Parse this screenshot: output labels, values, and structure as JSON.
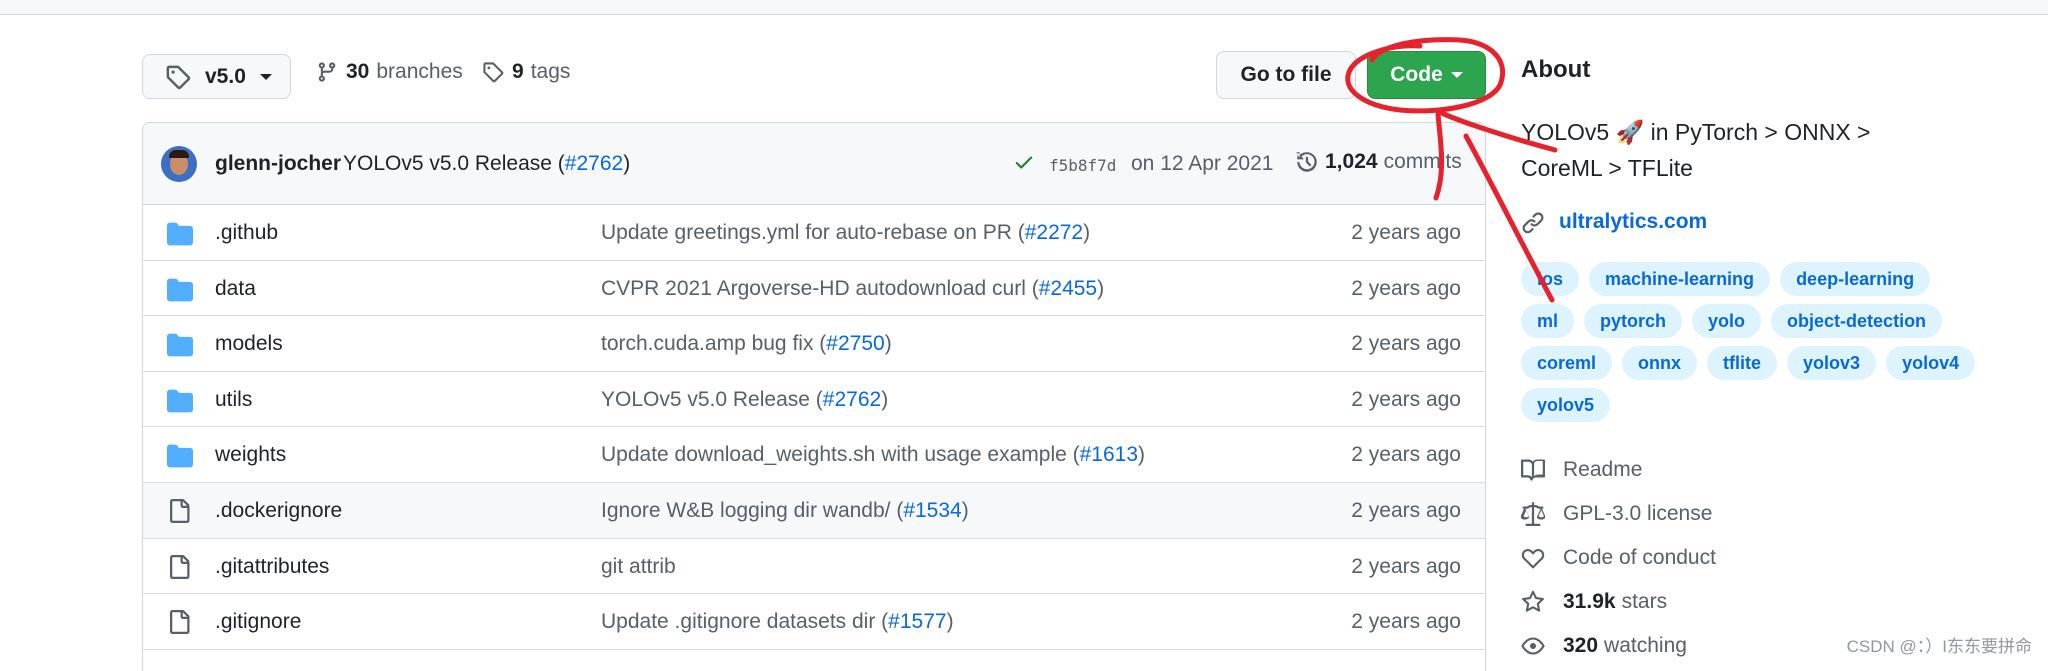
{
  "toolbar": {
    "branch": "v5.0",
    "branches_count": "30",
    "branches_label": "branches",
    "tags_count": "9",
    "tags_label": "tags",
    "go_to_file": "Go to file",
    "code": "Code"
  },
  "latest_commit": {
    "author": "glenn-jocher",
    "message": "YOLOv5 v5.0 Release (",
    "pr": "#2762",
    "message_end": ")",
    "sha": "f5b8f7d",
    "date": "on 12 Apr 2021",
    "commit_count": "1,024",
    "commit_label": "commits"
  },
  "files": [
    {
      "type": "dir",
      "name": ".github",
      "msg": "Update greetings.yml for auto-rebase on PR (",
      "pr": "#2272",
      "end": ")",
      "age": "2 years ago"
    },
    {
      "type": "dir",
      "name": "data",
      "msg": "CVPR 2021 Argoverse-HD autodownload curl (",
      "pr": "#2455",
      "end": ")",
      "age": "2 years ago"
    },
    {
      "type": "dir",
      "name": "models",
      "msg": "torch.cuda.amp bug fix (",
      "pr": "#2750",
      "end": ")",
      "age": "2 years ago"
    },
    {
      "type": "dir",
      "name": "utils",
      "msg": "YOLOv5 v5.0 Release (",
      "pr": "#2762",
      "end": ")",
      "age": "2 years ago"
    },
    {
      "type": "dir",
      "name": "weights",
      "msg": "Update download_weights.sh with usage example (",
      "pr": "#1613",
      "end": ")",
      "age": "2 years ago"
    },
    {
      "type": "file",
      "name": ".dockerignore",
      "msg": "Ignore W&B logging dir wandb/ (",
      "pr": "#1534",
      "end": ")",
      "age": "2 years ago"
    },
    {
      "type": "file",
      "name": ".gitattributes",
      "msg": "git attrib",
      "pr": "",
      "end": "",
      "age": "2 years ago"
    },
    {
      "type": "file",
      "name": ".gitignore",
      "msg": "Update .gitignore datasets dir (",
      "pr": "#1577",
      "end": ")",
      "age": "2 years ago"
    }
  ],
  "about": {
    "title": "About",
    "desc_line1": "YOLOv5 🚀 in PyTorch > ONNX >",
    "desc_line2": "CoreML > TFLite",
    "website": "ultralytics.com",
    "topics": [
      "ios",
      "machine-learning",
      "deep-learning",
      "ml",
      "pytorch",
      "yolo",
      "object-detection",
      "coreml",
      "onnx",
      "tflite",
      "yolov3",
      "yolov4",
      "yolov5"
    ],
    "readme": "Readme",
    "license": "GPL-3.0 license",
    "conduct": "Code of conduct",
    "stars_count": "31.9k",
    "stars_label": "stars",
    "watching_count": "320",
    "watching_label": "watching"
  },
  "watermark": "CSDN @：）I东东要拼命",
  "colors": {
    "accent": "#0969da",
    "code_button": "#2da44e",
    "annotation": "#e8222c",
    "folder": "#54aeff"
  }
}
